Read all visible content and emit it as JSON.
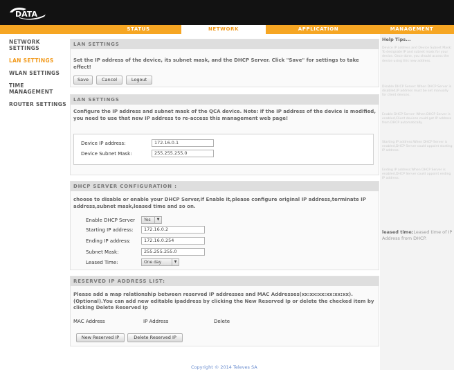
{
  "brand": {
    "logo_text": "DATA"
  },
  "nav": {
    "tabs": [
      "STATUS",
      "NETWORK",
      "APPLICATION",
      "MANAGEMENT"
    ],
    "active": "NETWORK"
  },
  "sidebar": {
    "items": [
      "NETWORK SETTINGS",
      "LAN SETTINGS",
      "WLAN SETTINGS",
      "TIME MANAGEMENT",
      "ROUTER SETTINGS"
    ],
    "active": "LAN SETTINGS"
  },
  "lan_top": {
    "header": "LAN SETTINGS",
    "description": "Set the IP address of the device, its subnet mask, and the DHCP Server. Click \"Save\" for settings to take effect!",
    "save_label": "Save",
    "cancel_label": "Cancel",
    "logout_label": "Logout"
  },
  "lan_cfg": {
    "header": "LAN SETTINGS",
    "description": "Configure the IP address and subnet mask of the QCA device. Note: if the IP address of the device is modified, you need to use that new IP address to re-access this management web page!",
    "ip_label": "Device IP address:",
    "ip_value": "172.16.0.1",
    "mask_label": "Device Subnet Mask:",
    "mask_value": "255.255.255.0"
  },
  "dhcp": {
    "header": "DHCP SERVER CONFIGURATION :",
    "description": "choose to disable or enable your DHCP Server,if Enable it,please configure original IP address,terminate IP address,subnet mask,leased time and so on.",
    "enable_label": "Enable DHCP Server",
    "enable_value": "Yes",
    "start_label": "Starting IP address:",
    "start_value": "172.16.0.2",
    "end_label": "Ending IP address:",
    "end_value": "172.16.0.254",
    "mask_label": "Subnet Mask:",
    "mask_value": "255.255.255.0",
    "lease_label": "Leased Time:",
    "lease_value": "One day"
  },
  "reserved": {
    "header": "RESERVED IP ADDRESS LIST:",
    "description": "Please add a map relationship between reserved IP addresses and MAC Addresses(xx:xx:xx:xx:xx:xx).(Optional).You can add new editable ipaddress by clicking the New Reserved Ip or delete the checked item by clicking Delete Reserved Ip",
    "columns": [
      "MAC Address",
      "IP Address",
      "Delete"
    ],
    "new_label": "New Reserved IP",
    "delete_label": "Delete Reserved IP"
  },
  "help": {
    "title": "Help Tips...",
    "tips": [
      "Device IP address and Device Subnet Mask: To designate IP and subnet mask for your device. Once done, you should access the device using this new address.",
      "Disable DHCP Server: When DHCP Server is disabled,IP address must be set manually for client devices.",
      "Enable DHCP Server: When DHCP Server is enabled,Client devices could get IP address from DHCP automatically.",
      "Starting IP address:When DHCP Server is enabled,DHCP Server could appoint starting IP address.",
      "Ending IP address:When DHCP Server is enabled,DHCP Server could appoint ending IP address."
    ],
    "lease_term": "leased time:",
    "lease_text": "Leased time of IP Address from DHCP."
  },
  "footer": {
    "text": "Copyright © 2014 Televes SA"
  },
  "colors": {
    "accent": "#f6a623",
    "topbar": "#121212",
    "link": "#6a8dcf"
  }
}
